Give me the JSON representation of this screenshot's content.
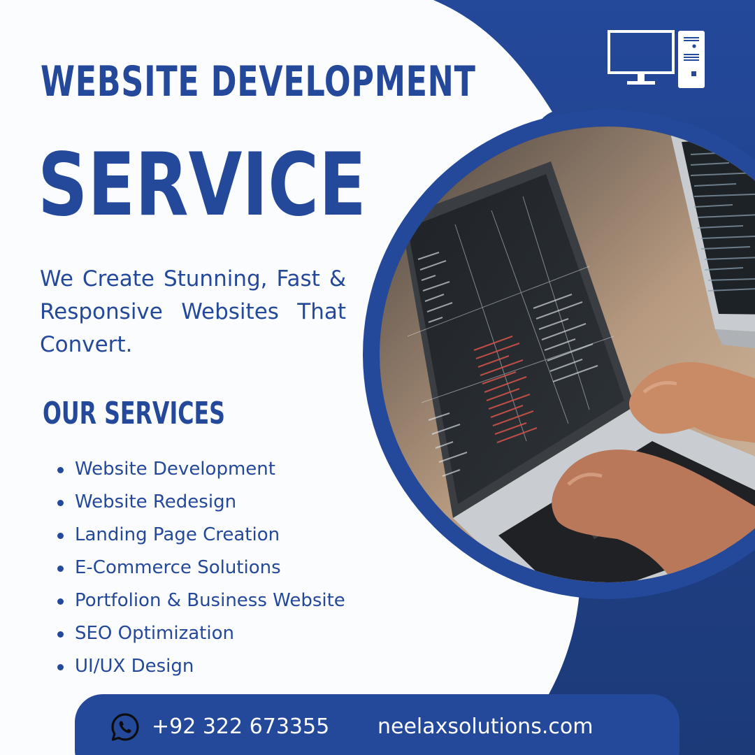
{
  "title": {
    "line1": "WEBSITE DEVELOPMENT",
    "line2": "SERVICE"
  },
  "tagline": "We Create Stunning, Fast & Responsive Websites That Convert.",
  "services": {
    "heading": "OUR SERVICES",
    "items": [
      "Website Development",
      "Website Redesign",
      "Landing Page Creation",
      "E-Commerce Solutions",
      "Portfolion & Business Website",
      "SEO Optimization",
      "UI/UX Design"
    ]
  },
  "contact": {
    "phone": "+92 322 673355",
    "website": "neelaxsolutions.com"
  },
  "icons": {
    "top_right": "desktop-computer-icon",
    "contact": "whatsapp-icon"
  },
  "colors": {
    "brand_blue": "#24489a",
    "dark_navy": "#1c3a78",
    "background": "#fbfcfd",
    "text_on_blue": "#ffffff"
  }
}
